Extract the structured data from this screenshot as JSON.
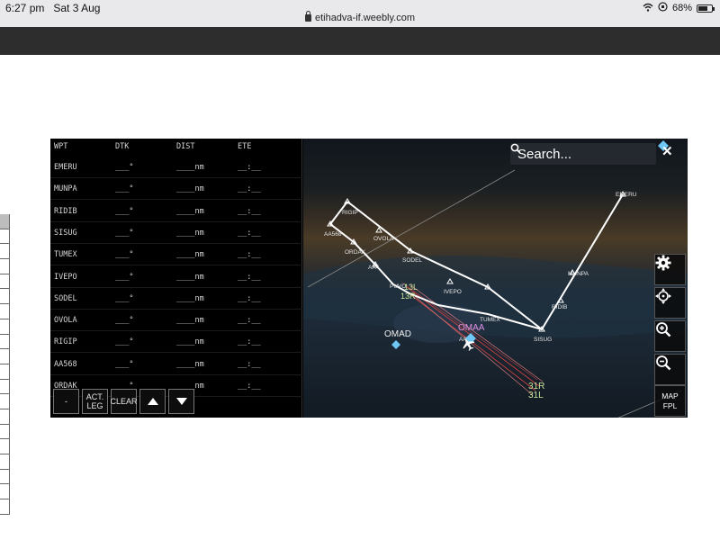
{
  "status_bar": {
    "time": "6:27 pm",
    "date": "Sat 3 Aug",
    "url": "etihadva-if.weebly.com",
    "battery": "68%",
    "battery_level": 0.68
  },
  "fpl": {
    "headers": {
      "wpt": "WPT",
      "dtk": "DTK",
      "dist": "DIST",
      "ete": "ETE"
    },
    "rows": [
      {
        "wpt": "EMERU",
        "dtk": "___°",
        "dist": "____nm",
        "ete": "__:__"
      },
      {
        "wpt": "MUNPA",
        "dtk": "___°",
        "dist": "____nm",
        "ete": "__:__"
      },
      {
        "wpt": "RIDIB",
        "dtk": "___°",
        "dist": "____nm",
        "ete": "__:__"
      },
      {
        "wpt": "SISUG",
        "dtk": "___°",
        "dist": "____nm",
        "ete": "__:__"
      },
      {
        "wpt": "TUMEX",
        "dtk": "___°",
        "dist": "____nm",
        "ete": "__:__"
      },
      {
        "wpt": "IVEPO",
        "dtk": "___°",
        "dist": "____nm",
        "ete": "__:__"
      },
      {
        "wpt": "SODEL",
        "dtk": "___°",
        "dist": "____nm",
        "ete": "__:__"
      },
      {
        "wpt": "OVOLA",
        "dtk": "___°",
        "dist": "____nm",
        "ete": "__:__"
      },
      {
        "wpt": "RIGIP",
        "dtk": "___°",
        "dist": "____nm",
        "ete": "__:__"
      },
      {
        "wpt": "AA568",
        "dtk": "___°",
        "dist": "____nm",
        "ete": "__:__"
      },
      {
        "wpt": "ORDAK",
        "dtk": "___°",
        "dist": "____nm",
        "ete": "__:__"
      }
    ],
    "buttons": {
      "minus": "-",
      "act_leg_1": "ACT.",
      "act_leg_2": "LEG",
      "clear": "CLEAR"
    }
  },
  "map": {
    "search_placeholder": "Search...",
    "close": "✕",
    "map_btn_1": "MAP",
    "map_btn_2": "FPL",
    "waypoints": {
      "emeru": "EMERU",
      "munpa": "MUNPA",
      "ridib": "RIDIB",
      "sisug": "SISUG",
      "tumex": "TUMEX",
      "ivepo": "IVEPO",
      "sodel": "SODEL",
      "ovola": "OVOLA",
      "rigip": "RIGIP",
      "aa568": "AA568",
      "ordak": "ORDAK",
      "aa4": "AA4",
      "aa4b": "AA4",
      "pivot": "PUVO",
      "s13l": "13L",
      "s13r": "13R"
    },
    "airports": {
      "omad": "OMAD",
      "omaa": "OMAA"
    },
    "runways": {
      "r31r": "31R",
      "r31l": "31L"
    },
    "colors": {
      "route": "#ffffff",
      "airport": "#6fc7f5",
      "omaa": "#e08ee0",
      "runway": "#c6e59a",
      "approach": "#c94040"
    }
  }
}
